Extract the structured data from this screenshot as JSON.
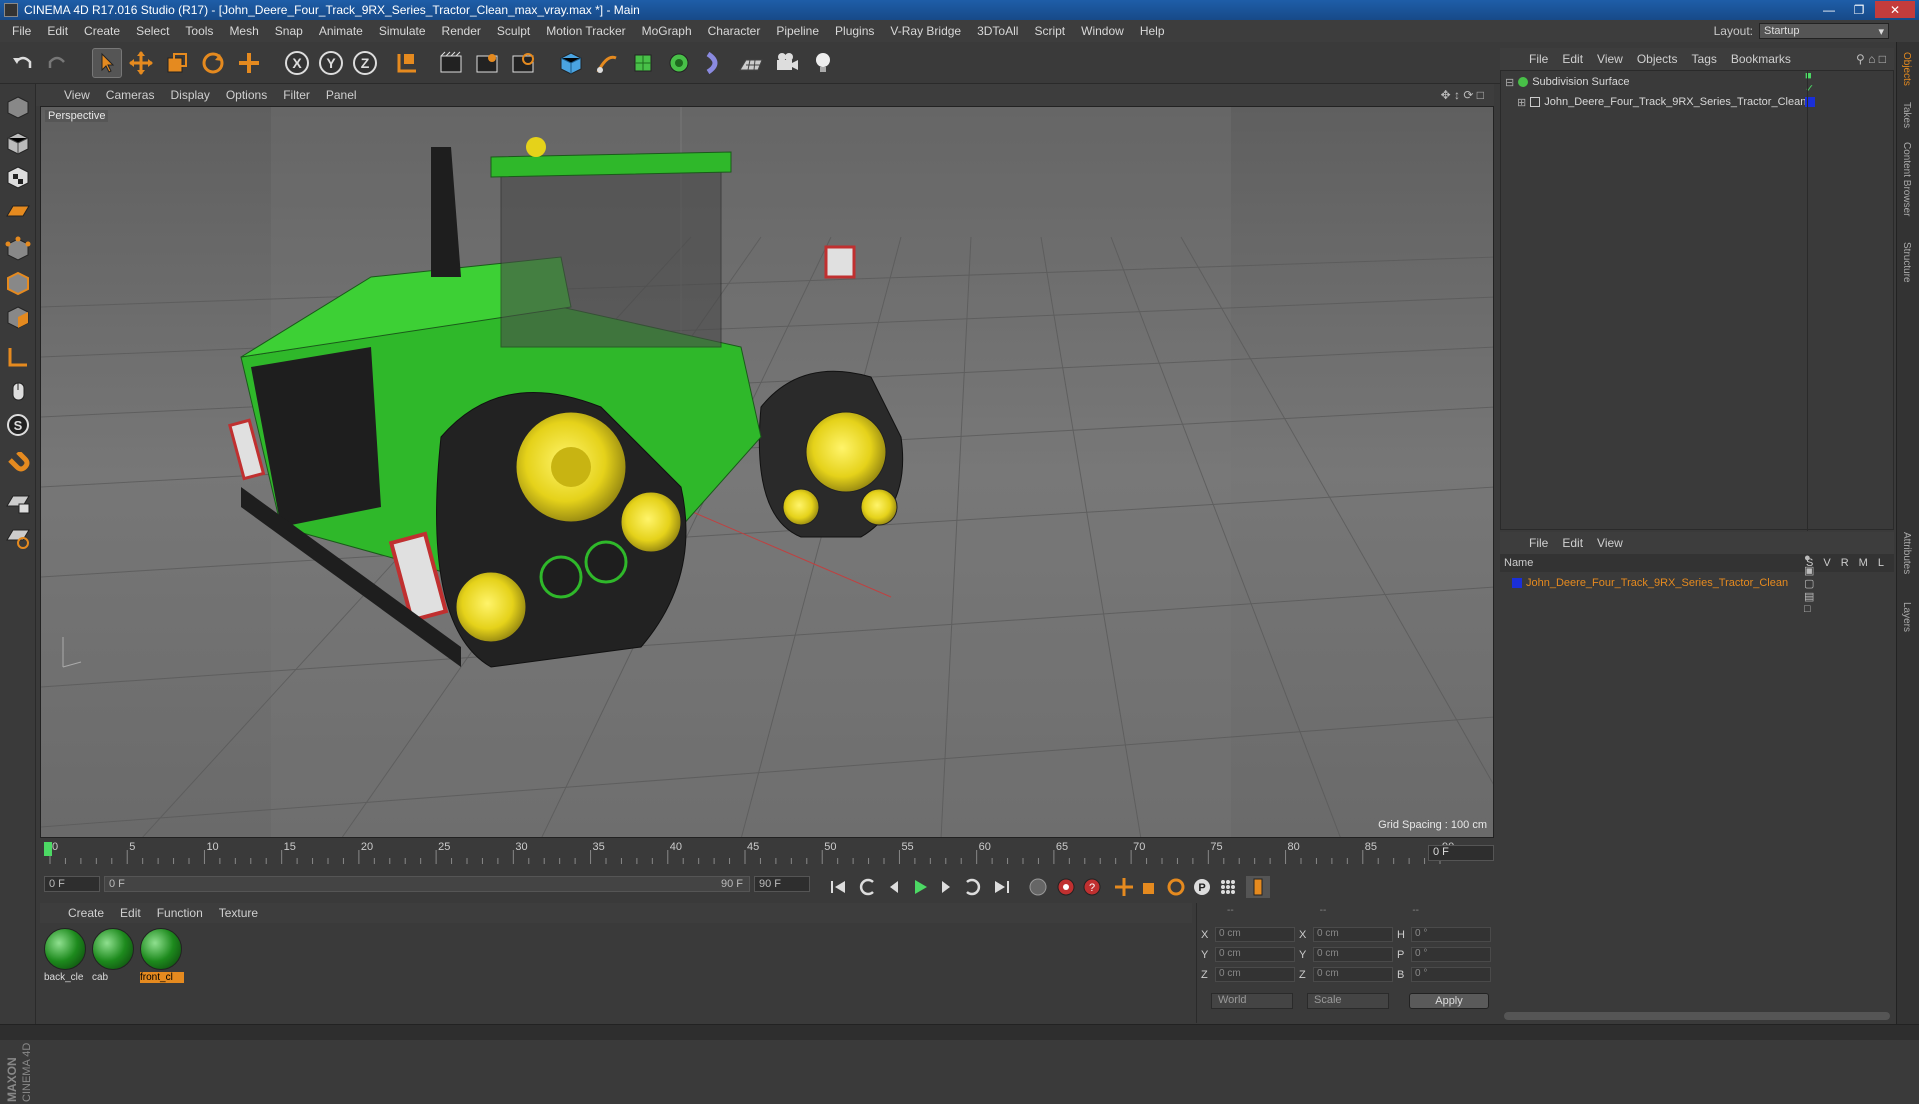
{
  "titlebar": {
    "text": "CINEMA 4D R17.016 Studio (R17) - [John_Deere_Four_Track_9RX_Series_Tractor_Clean_max_vray.max *] - Main"
  },
  "menubar": [
    "File",
    "Edit",
    "Create",
    "Select",
    "Tools",
    "Mesh",
    "Snap",
    "Animate",
    "Simulate",
    "Render",
    "Sculpt",
    "Motion Tracker",
    "MoGraph",
    "Character",
    "Pipeline",
    "Plugins",
    "V-Ray Bridge",
    "3DToAll",
    "Script",
    "Window",
    "Help"
  ],
  "layout": {
    "label": "Layout:",
    "value": "Startup"
  },
  "toolbar_icons": [
    "undo-icon",
    "redo-icon",
    "select-icon",
    "move-icon",
    "scale-icon",
    "rotate-icon",
    "live-select-icon",
    "x-axis-icon",
    "y-axis-icon",
    "z-axis-icon",
    "coordinate-system-icon",
    "render-view-icon",
    "render-picture-viewer-icon",
    "render-settings-icon",
    "cube-icon",
    "pen-icon",
    "subdivision-icon",
    "cloner-icon",
    "deformer-icon",
    "floor-icon",
    "camera-icon",
    "light-icon"
  ],
  "viewport_menu": [
    "View",
    "Cameras",
    "Display",
    "Options",
    "Filter",
    "Panel"
  ],
  "viewport": {
    "label": "Perspective",
    "grid_spacing": "Grid Spacing : 100 cm"
  },
  "timeline": {
    "ticks": [
      "0",
      "5",
      "10",
      "15",
      "20",
      "25",
      "30",
      "35",
      "40",
      "45",
      "50",
      "55",
      "60",
      "65",
      "70",
      "75",
      "80",
      "85",
      "90"
    ],
    "current_frame": "0 F",
    "start_field": "0 F",
    "range_start": "0 F",
    "range_end": "90 F",
    "end_field": "90 F"
  },
  "material_menu": [
    "Create",
    "Edit",
    "Function",
    "Texture"
  ],
  "materials": [
    {
      "name": "back_cle",
      "selected": false
    },
    {
      "name": "cab",
      "selected": false
    },
    {
      "name": "front_cl",
      "selected": true
    }
  ],
  "coords": {
    "headers": [
      "--",
      "--",
      "--"
    ],
    "rows": [
      {
        "a": "X",
        "av": "0 cm",
        "b": "X",
        "bv": "0 cm",
        "c": "H",
        "cv": "0 °"
      },
      {
        "a": "Y",
        "av": "0 cm",
        "b": "Y",
        "bv": "0 cm",
        "c": "P",
        "cv": "0 °"
      },
      {
        "a": "Z",
        "av": "0 cm",
        "b": "Z",
        "bv": "0 cm",
        "c": "B",
        "cv": "0 °"
      }
    ],
    "world": "World",
    "scale": "Scale",
    "apply": "Apply"
  },
  "object_menu": [
    "File",
    "Edit",
    "View",
    "Objects",
    "Tags",
    "Bookmarks"
  ],
  "objects": [
    {
      "name": "Subdivision Surface"
    },
    {
      "name": "John_Deere_Four_Track_9RX_Series_Tractor_Clean"
    }
  ],
  "layer_menu": [
    "File",
    "Edit",
    "View"
  ],
  "layer_header": {
    "name": "Name",
    "cols": [
      "S",
      "V",
      "R",
      "M",
      "L"
    ]
  },
  "layers": [
    {
      "name": "John_Deere_Four_Track_9RX_Series_Tractor_Clean"
    }
  ],
  "right_tabs": [
    "Objects",
    "Takes",
    "Content Browser",
    "Structure",
    "Attributes",
    "Layers"
  ],
  "logo": {
    "brand": "MAXON",
    "product": "CINEMA 4D"
  },
  "colors": {
    "accent": "#e58a1f",
    "tractor_green": "#2fb82a",
    "wheel_yellow": "#e5d21a",
    "layer_blue": "#1a2fd8"
  }
}
